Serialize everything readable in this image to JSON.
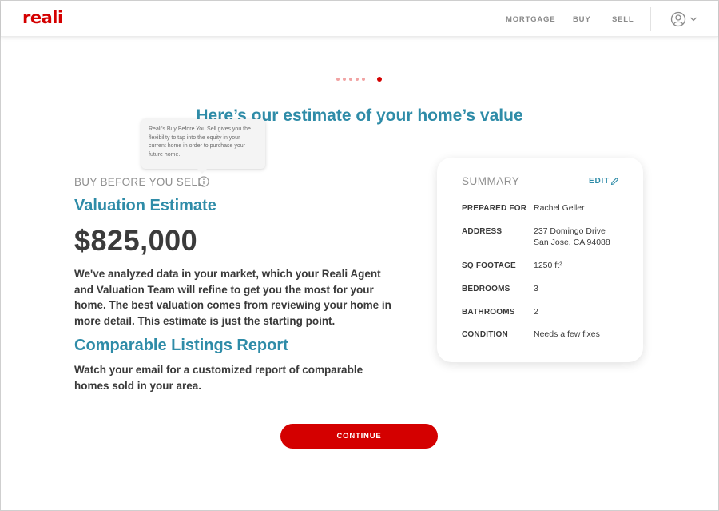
{
  "header": {
    "logo": "reali",
    "nav": [
      "MORTGAGE",
      "BUY",
      "SELL"
    ]
  },
  "progress": {
    "total": 6,
    "current": 6
  },
  "headline": "Here’s our estimate of your home’s value",
  "tooltip": "Reali’s Buy Before You Sell gives you the flexibility to tap into the equity in your current home in order to purchase your future home.",
  "main": {
    "eyebrow": "BUY BEFORE YOU SELL",
    "valuation_title": "Valuation Estimate",
    "price": "$825,000",
    "valuation_text": "We've analyzed data in your market, which your Reali Agent and Valuation Team will refine to get you the most for your home. The best valuation comes from reviewing your home in more detail. This estimate is just the starting point.",
    "report_title": "Comparable Listings Report",
    "report_text": "Watch your email for a customized report of comparable homes sold in your area."
  },
  "summary": {
    "title": "SUMMARY",
    "edit_label": "EDIT",
    "rows": [
      {
        "label": "PREPARED FOR",
        "value": [
          "Rachel Geller"
        ]
      },
      {
        "label": "ADDRESS",
        "value": [
          "237 Domingo Drive",
          "San Jose, CA 94088"
        ]
      },
      {
        "label": "SQ FOOTAGE",
        "value": [
          "1250 ft²"
        ]
      },
      {
        "label": "BEDROOMS",
        "value": [
          "3"
        ]
      },
      {
        "label": "BATHROOMS",
        "value": [
          "2"
        ]
      },
      {
        "label": "CONDITION",
        "value": [
          "Needs a few fixes"
        ]
      }
    ]
  },
  "continue_label": "CONTINUE",
  "colors": {
    "brand": "#d40000",
    "accent": "#2f8ca8",
    "muted": "#8f8f8f"
  },
  "icons": {
    "info": "info-icon",
    "edit": "pencil-icon",
    "user": "user-icon",
    "chevron": "chevron-down-icon"
  }
}
